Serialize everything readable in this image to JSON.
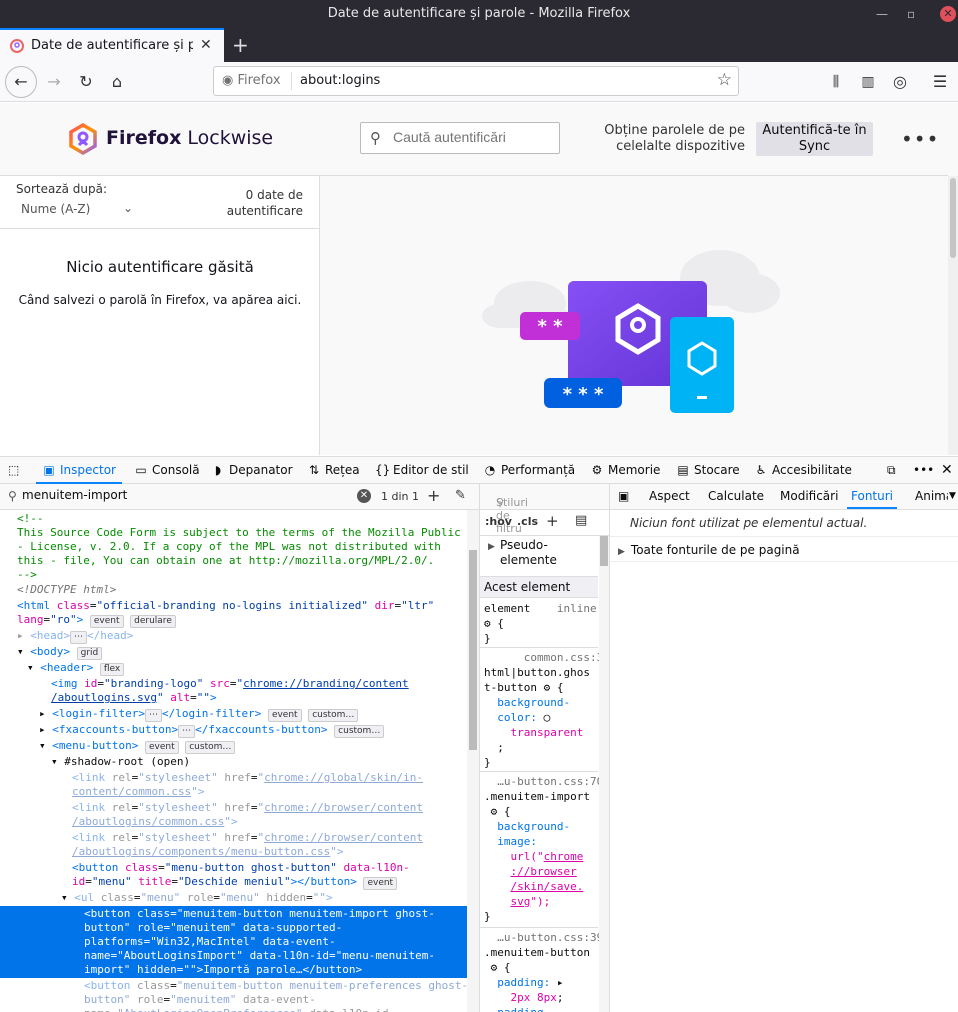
{
  "window": {
    "title": "Date de autentificare și parole - Mozilla Firefox"
  },
  "tab": {
    "title": "Date de autentificare și parole",
    "close": "✕",
    "new": "+"
  },
  "nav": {
    "identity": "Firefox",
    "url": "about:logins"
  },
  "lockwise": {
    "brand_a": "Firefox",
    "brand_b": "Lockwise",
    "search_placeholder": "Caută autentificări",
    "sync_msg": "Obține parolele de pe celelalte dispozitive",
    "sync_btn": "Autentifică-te în Sync",
    "sort_label": "Sortează după:",
    "sort_value": "Nume (A-Z)",
    "count": "0 date de autentificare",
    "empty_title": "Nicio autentificare găsită",
    "empty_body": "Când salvezi o parolă în Firefox, va apărea aici.",
    "pw1": "* *",
    "pw2": "* * *"
  },
  "devtools": {
    "tabs": [
      "Inspector",
      "Consolă",
      "Depanator",
      "Rețea",
      "Editor de stil",
      "Performanță",
      "Memorie",
      "Stocare",
      "Accesibilitate"
    ],
    "search_value": "menuitem-import",
    "match_count": "1 din 1",
    "rules_filter_placeholder": "Stiluri de filtru",
    "rules_tools": [
      ":hov",
      ".cls"
    ],
    "pseudo": "Pseudo-elemente",
    "this_element": "Acest element",
    "layout_tabs": [
      "Aspect",
      "Calculate",
      "Modificări",
      "Fonturi",
      "Anima"
    ],
    "no_font": "Niciun font utilizat pe elementul actual.",
    "all_fonts": "Toate fonturile de pe pagină"
  },
  "colors": {
    "accent": "#0a84ff",
    "selection": "#0074e8",
    "titlebar": "#2b2a33"
  }
}
